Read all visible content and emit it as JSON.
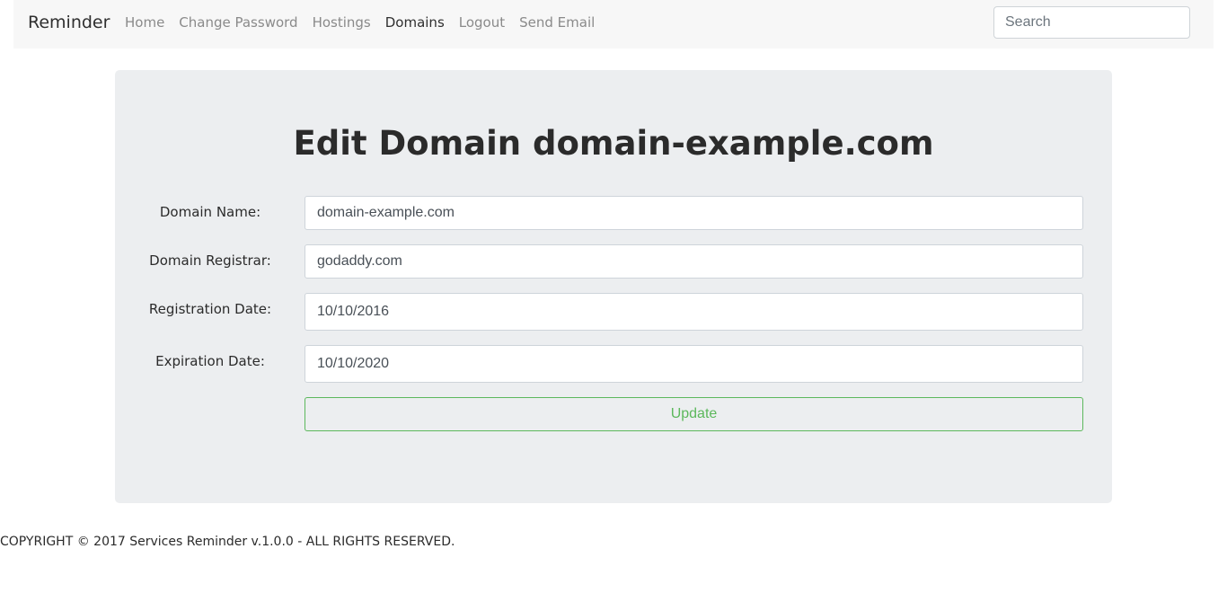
{
  "navbar": {
    "brand": "Reminder",
    "links": [
      {
        "label": "Home",
        "active": false
      },
      {
        "label": "Change Password",
        "active": false
      },
      {
        "label": "Hostings",
        "active": false
      },
      {
        "label": "Domains",
        "active": true
      },
      {
        "label": "Logout",
        "active": false
      },
      {
        "label": "Send Email",
        "active": false
      }
    ],
    "search": {
      "placeholder": "Search",
      "value": ""
    }
  },
  "form": {
    "title": "Edit Domain domain-example.com",
    "domain_name": {
      "label": "Domain Name:",
      "value": "domain-example.com"
    },
    "domain_registrar": {
      "label": "Domain Registrar:",
      "value": "godaddy.com"
    },
    "registration_date": {
      "label": "Registration Date:",
      "value": "10/10/2016"
    },
    "expiration_date": {
      "label": "Expiration Date:",
      "value": "10/10/2020"
    },
    "submit_label": "Update"
  },
  "footer": {
    "text": "COPYRIGHT © 2017 Services Reminder v.1.0.0 - ALL RIGHTS RESERVED."
  },
  "colors": {
    "navbar_bg": "#f7f7f7",
    "jumbotron_bg": "#eceef0",
    "success": "#5cb85c",
    "nav_link": "#8a8a8a",
    "nav_link_active": "#2f2f2f"
  }
}
